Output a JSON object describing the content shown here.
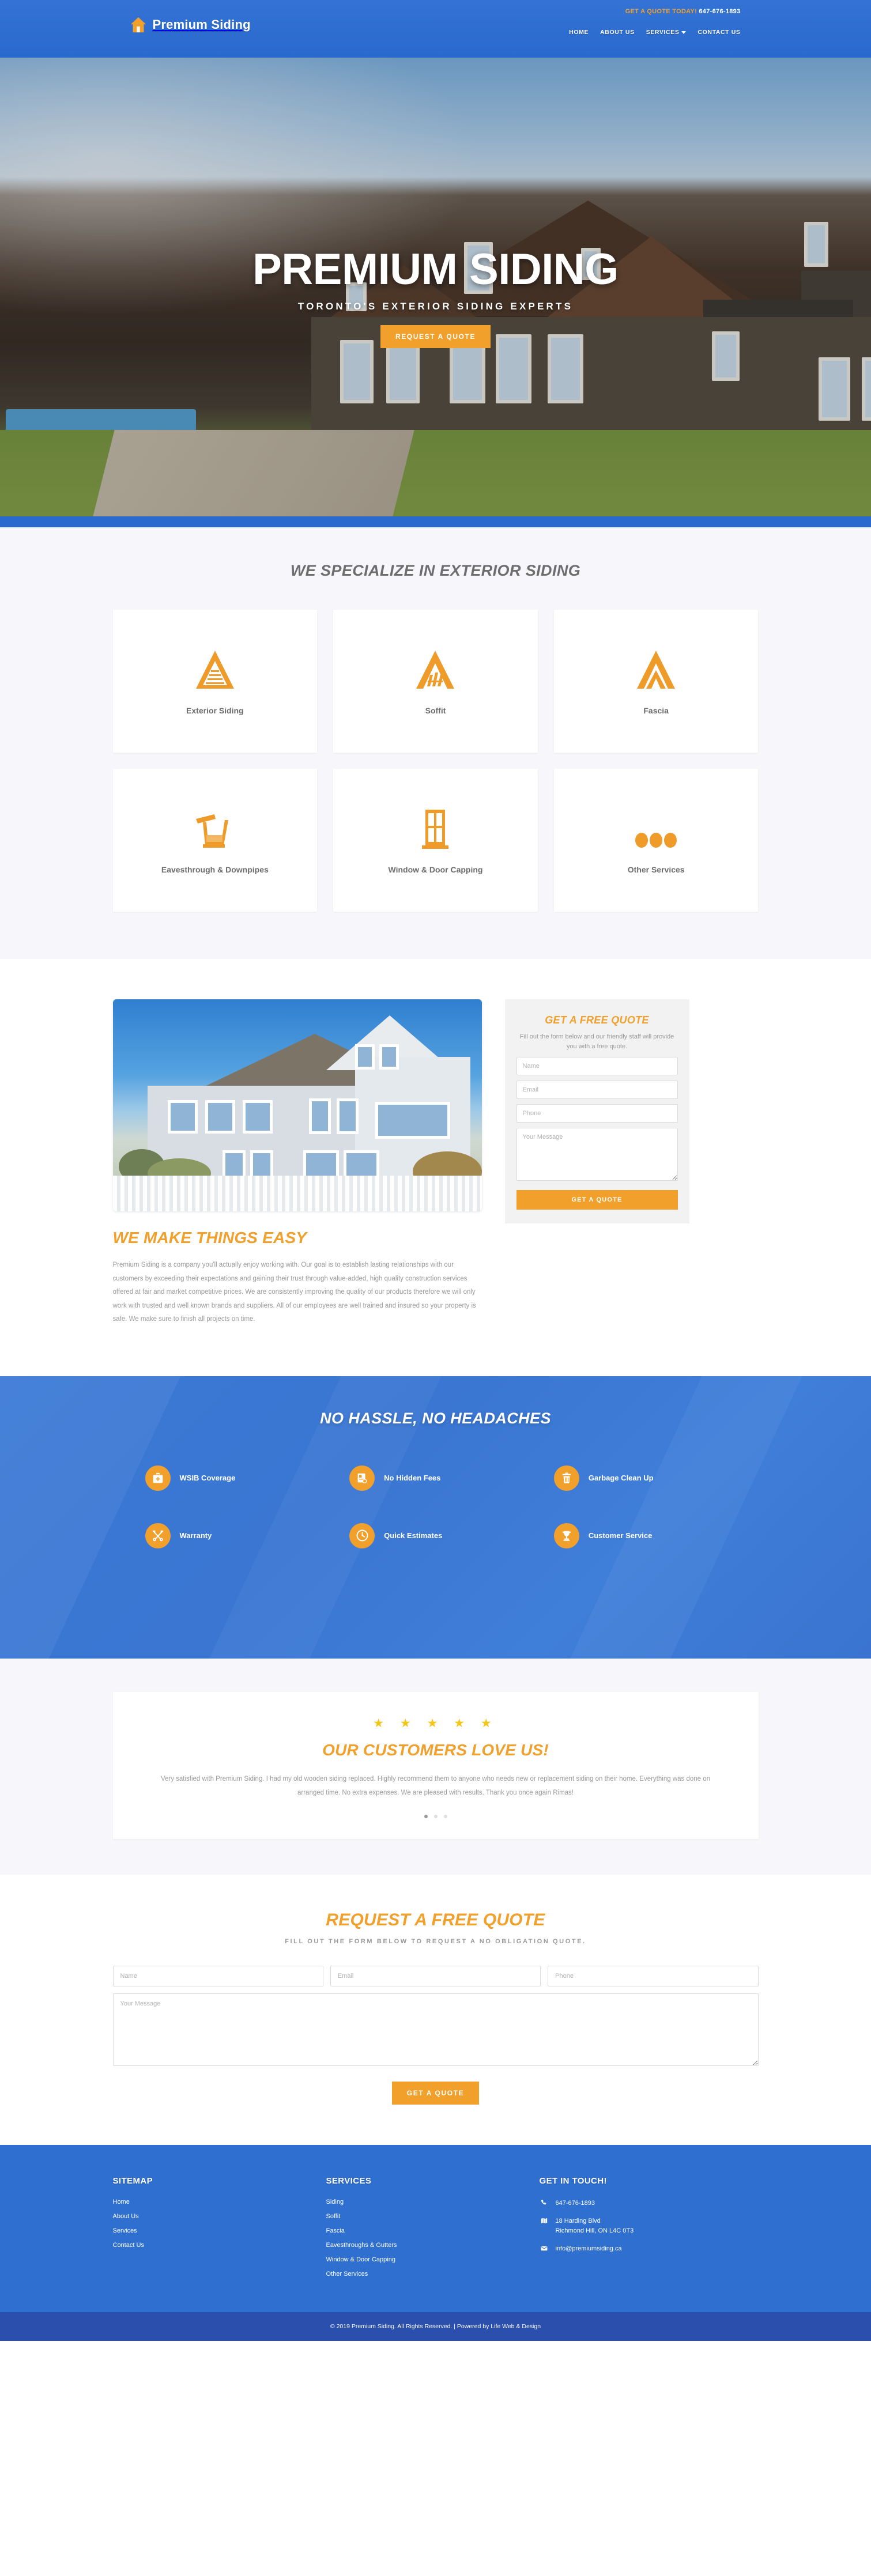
{
  "brand": {
    "name": "Premium Siding",
    "icon": "house-icon"
  },
  "header": {
    "quote_label": "GET A QUOTE TODAY!",
    "phone": "647-676-1893",
    "nav": [
      {
        "label": "HOME",
        "caret": false
      },
      {
        "label": "ABOUT US",
        "caret": false
      },
      {
        "label": "SERVICES",
        "caret": true
      },
      {
        "label": "CONTACT US",
        "caret": false
      }
    ]
  },
  "hero": {
    "title": "PREMIUM SIDING",
    "subtitle": "TORONTO'S EXTERIOR SIDING EXPERTS",
    "cta": "REQUEST A QUOTE"
  },
  "specialize": {
    "title": "WE SPECIALIZE IN EXTERIOR SIDING",
    "cards": [
      {
        "label": "Exterior Siding",
        "icon": "siding-triangle-icon"
      },
      {
        "label": "Soffit",
        "icon": "soffit-chevron-icon"
      },
      {
        "label": "Fascia",
        "icon": "fascia-peak-icon"
      },
      {
        "label": "Eavesthrough & Downpipes",
        "icon": "gutter-icon"
      },
      {
        "label": "Window & Door Capping",
        "icon": "window-icon"
      },
      {
        "label": "Other Services",
        "icon": "ellipsis-icon"
      }
    ]
  },
  "about": {
    "heading": "WE MAKE THINGS EASY",
    "body": "Premium Siding is a company you'll actually enjoy working with. Our goal is to establish lasting relationships with our customers by exceeding their expectations and gaining their trust through value-added, high quality construction services offered at fair and market competitive prices. We are consistently improving the quality of our products therefore we will only work with trusted and well known brands and suppliers. All of our employees are well trained and insured so your property is safe. We make sure to finish all projects on time.",
    "photo_alt": "white-siding-house-photo"
  },
  "quote_box": {
    "title": "GET A FREE QUOTE",
    "subtitle": "Fill out the form below and our friendly staff will provide you with a free quote.",
    "name_placeholder": "Name",
    "email_placeholder": "Email",
    "phone_placeholder": "Phone",
    "message_placeholder": "Your Message",
    "submit": "GET A QUOTE"
  },
  "hassle": {
    "title": "NO HASSLE, NO HEADACHES",
    "features": [
      {
        "label": "WSIB Coverage",
        "icon": "first-aid-kit-icon"
      },
      {
        "label": "No Hidden Fees",
        "icon": "invoice-icon"
      },
      {
        "label": "Garbage Clean Up",
        "icon": "trash-icon"
      },
      {
        "label": "Warranty",
        "icon": "tools-icon"
      },
      {
        "label": "Quick Estimates",
        "icon": "clock-icon"
      },
      {
        "label": "Customer Service",
        "icon": "trophy-icon"
      }
    ]
  },
  "testimonial": {
    "stars": "★ ★ ★ ★ ★",
    "title": "OUR CUSTOMERS LOVE US!",
    "text": "Very satisfied with Premium Siding. I had my old wooden siding replaced. Highly recommend them to anyone who needs new or replacement siding on their home. Everything was done on arranged time. No extra expenses. We are pleased with results. Thank you once again Rimas!",
    "dots": 3,
    "active_dot": 0
  },
  "request": {
    "title": "REQUEST A FREE QUOTE",
    "subtitle": "FILL OUT THE FORM BELOW TO REQUEST A NO OBLIGATION QUOTE.",
    "name_placeholder": "Name",
    "email_placeholder": "Email",
    "phone_placeholder": "Phone",
    "message_placeholder": "Your Message",
    "submit": "GET A QUOTE"
  },
  "footer": {
    "sitemap_heading": "SITEMAP",
    "sitemap": [
      "Home",
      "About Us",
      "Services",
      "Contact Us"
    ],
    "services_heading": "SERVICES",
    "services": [
      "Siding",
      "Soffit",
      "Fascia",
      "Eavesthroughs & Gutters",
      "Window & Door Capping",
      "Other Services"
    ],
    "contact_heading": "GET IN TOUCH!",
    "phone": "647-676-1893",
    "address_line1": "18 Harding Blvd",
    "address_line2": "Richmond Hill, ON L4C 0T3",
    "email": "info@premiumsiding.ca",
    "copyright": "© 2019 Premium Siding. All Rights Reserved. | Powered by Life Web & Design"
  },
  "colors": {
    "brand_blue": "#2f6fd0",
    "accent_orange": "#f0a02b",
    "footer_bottom": "#2a4fad",
    "star_yellow": "#f5c518",
    "light_gray": "#f6f6fb"
  }
}
